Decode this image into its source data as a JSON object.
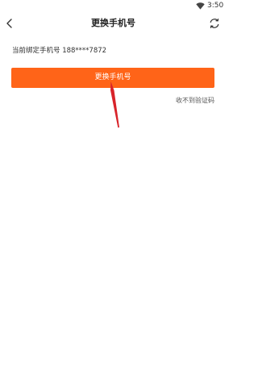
{
  "status_bar": {
    "time": "3:50",
    "wifi_icon": "wifi-icon"
  },
  "nav": {
    "back_icon": "back-arrow-icon",
    "title": "更换手机号",
    "refresh_icon": "refresh-icon"
  },
  "content": {
    "current_phone_text": "当前绑定手机号 188****7872",
    "change_button_label": "更换手机号",
    "no_code_link": "收不到验证码"
  },
  "colors": {
    "accent": "#ff6418",
    "annotation_arrow": "#d8232a"
  }
}
